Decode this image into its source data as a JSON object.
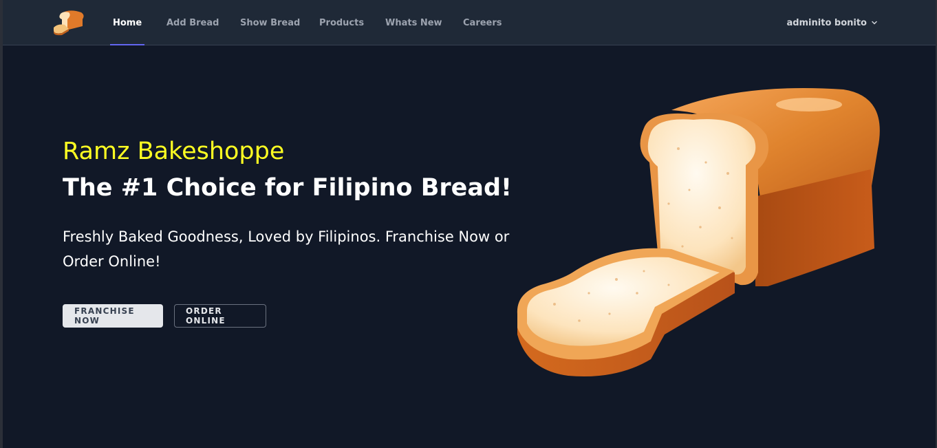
{
  "nav": {
    "items": [
      {
        "label": "Home",
        "active": true
      },
      {
        "label": "Add Bread"
      },
      {
        "label": "Show Bread"
      },
      {
        "label": "Products"
      },
      {
        "label": "Whats New"
      },
      {
        "label": "Careers"
      }
    ],
    "user": "adminito bonito"
  },
  "hero": {
    "brand": "Ramz Bakeshoppe",
    "headline": "The #1 Choice for Filipino Bread!",
    "tagline": "Freshly Baked Goodness, Loved by Filipinos. Franchise Now or Order Online!",
    "primary_button": "FRANCHISE NOW",
    "secondary_button": "ORDER ONLINE"
  },
  "colors": {
    "background": "#111827",
    "navbar": "#1f2937",
    "brand": "#ffff22",
    "active_indicator": "#6366f1"
  },
  "icons": {
    "logo": "bread-logo-icon",
    "user_menu": "chevron-down-icon",
    "hero_image": "bread-loaf-illustration"
  }
}
